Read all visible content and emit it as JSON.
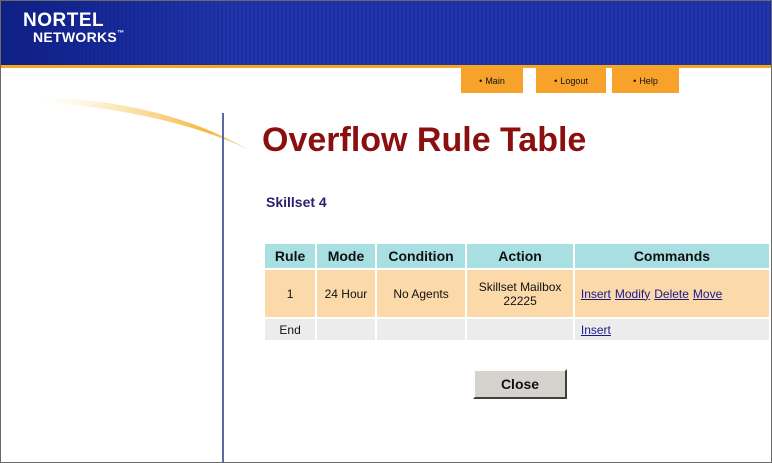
{
  "header": {
    "logo_line1": "NORTEL",
    "logo_line2": "NETWORKS",
    "logo_tm": "™"
  },
  "nav": [
    {
      "label": "Main"
    },
    {
      "label": "Logout"
    },
    {
      "label": "Help"
    }
  ],
  "nav_bullet": "•",
  "page_title": "Overflow Rule Table",
  "skillset_label": "Skillset 4",
  "table": {
    "headers": [
      "Rule",
      "Mode",
      "Condition",
      "Action",
      "Commands"
    ],
    "rows": [
      {
        "rule": "1",
        "mode": "24 Hour",
        "condition": "No Agents",
        "action_line1": "Skillset Mailbox",
        "action_line2": "22225",
        "commands": [
          "Insert",
          "Modify",
          "Delete",
          "Move"
        ]
      },
      {
        "rule": "End",
        "mode": "",
        "condition": "",
        "action": "",
        "commands": [
          "Insert"
        ]
      }
    ]
  },
  "close_button": "Close",
  "colors": {
    "header_blue": "#1c2fa0",
    "accent_orange": "#f7a22a",
    "title_red": "#8b0f0f",
    "table_header_cyan": "#a8dfe3",
    "row_peach": "#fcd9a9"
  }
}
